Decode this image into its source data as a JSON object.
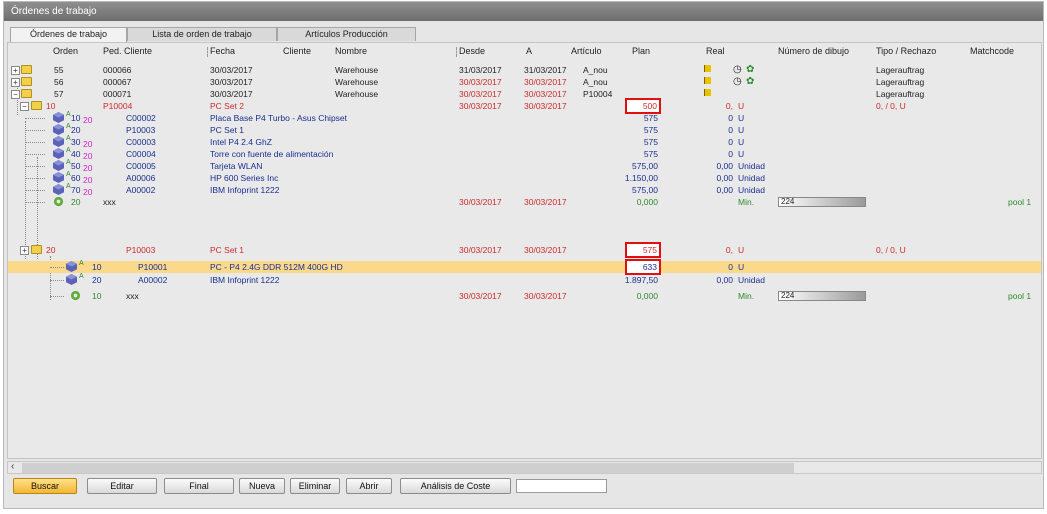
{
  "window": {
    "title": "Órdenes de trabajo"
  },
  "tabs": [
    {
      "label": "Órdenes de trabajo"
    },
    {
      "label": "Lista de orden de trabajo"
    },
    {
      "label": "Artículos Producción"
    }
  ],
  "columns": {
    "orden": "Orden",
    "ped_cliente": "Ped. Cliente",
    "fecha": "Fecha",
    "cliente": "Cliente",
    "nombre": "Nombre",
    "desde": "Desde",
    "a": "A",
    "articulo": "Artículo",
    "plan": "Plan",
    "real": "Real",
    "num_dibujo": "Número de dibujo",
    "tipo_rechazo": "Tipo / Rechazo",
    "matchcode": "Matchcode"
  },
  "rows": [
    {
      "orden": "55",
      "ped": "000066",
      "fecha": "30/03/2017",
      "nombre": "Warehouse",
      "desde": "31/03/2017",
      "a": "31/03/2017",
      "articulo": "A_nou",
      "tipo": "Lagerauftrag"
    },
    {
      "orden": "56",
      "ped": "000067",
      "fecha": "30/03/2017",
      "nombre": "Warehouse",
      "desde": "30/03/2017",
      "a": "30/03/2017",
      "articulo": "A_nou",
      "tipo": "Lagerauftrag"
    },
    {
      "orden": "57",
      "ped": "000071",
      "fecha": "30/03/2017",
      "nombre": "Warehouse",
      "desde": "30/03/2017",
      "a": "30/03/2017",
      "articulo": "P10004",
      "tipo": "Lagerauftrag"
    },
    {
      "orden": "10",
      "ped": "P10004",
      "fecha": "PC Set 2",
      "desde": "30/03/2017",
      "a": "30/03/2017",
      "plan": "500",
      "real": "0,",
      "unit": "U",
      "tipo": "0, / 0, U"
    },
    {
      "orden": "10",
      "sub": "20",
      "ped": "C00002",
      "fecha": "Placa Base P4 Turbo - Asus Chipset",
      "plan": "575",
      "real": "0",
      "unit": "U"
    },
    {
      "orden": "20",
      "ped": "P10003",
      "fecha": "PC Set 1",
      "plan": "575",
      "real": "0",
      "unit": "U"
    },
    {
      "orden": "30",
      "sub": "20",
      "ped": "C00003",
      "fecha": "Intel P4 2.4 GhZ",
      "plan": "575",
      "real": "0",
      "unit": "U"
    },
    {
      "orden": "40",
      "sub": "20",
      "ped": "C00004",
      "fecha": "Torre con fuente de alimentación",
      "plan": "575",
      "real": "0",
      "unit": "U"
    },
    {
      "orden": "50",
      "sub": "20",
      "ped": "C00005",
      "fecha": "Tarjeta WLAN",
      "plan": "575,00",
      "real": "0,00",
      "unit": "Unidad"
    },
    {
      "orden": "60",
      "sub": "20",
      "ped": "A00006",
      "fecha": "HP 600 Series Inc",
      "plan": "1.150,00",
      "real": "0,00",
      "unit": "Unidad"
    },
    {
      "orden": "70",
      "sub": "20",
      "ped": "A00002",
      "fecha": "IBM Infoprint 1222",
      "plan": "575,00",
      "real": "0,00",
      "unit": "Unidad"
    },
    {
      "orden": "20",
      "ped": "xxx",
      "desde": "30/03/2017",
      "a": "30/03/2017",
      "plan": "0,000",
      "unit": "Min.",
      "dibujo": "224",
      "match": "pool 1"
    },
    {
      "orden": "20",
      "ped": "P10003",
      "fecha": "PC Set 1",
      "desde": "30/03/2017",
      "a": "30/03/2017",
      "plan": "575",
      "real": "0,",
      "unit": "U",
      "tipo": "0, / 0, U"
    },
    {
      "orden": "10",
      "ped": "P10001",
      "fecha": "PC - P4 2.4G DDR 512M 400G HD",
      "plan": "633",
      "real": "0",
      "unit": "U"
    },
    {
      "orden": "20",
      "ped": "A00002",
      "fecha": "IBM Infoprint 1222",
      "plan": "1.897,50",
      "real": "0,00",
      "unit": "Unidad"
    },
    {
      "orden": "10",
      "ped": "xxx",
      "desde": "30/03/2017",
      "a": "30/03/2017",
      "plan": "0,000",
      "unit": "Min.",
      "dibujo": "224",
      "match": "pool 1"
    }
  ],
  "buttons": {
    "buscar": "Buscar",
    "editar": "Editar",
    "final": "Final",
    "nueva": "Nueva",
    "eliminar": "Eliminar",
    "abrir": "Abrir",
    "analisis": "Análisis de Coste"
  },
  "search_field": {
    "value": ""
  },
  "colors": {
    "accent": "#f3b733",
    "selected_row": "#fbd98a",
    "highlight_box": "#e01010"
  }
}
